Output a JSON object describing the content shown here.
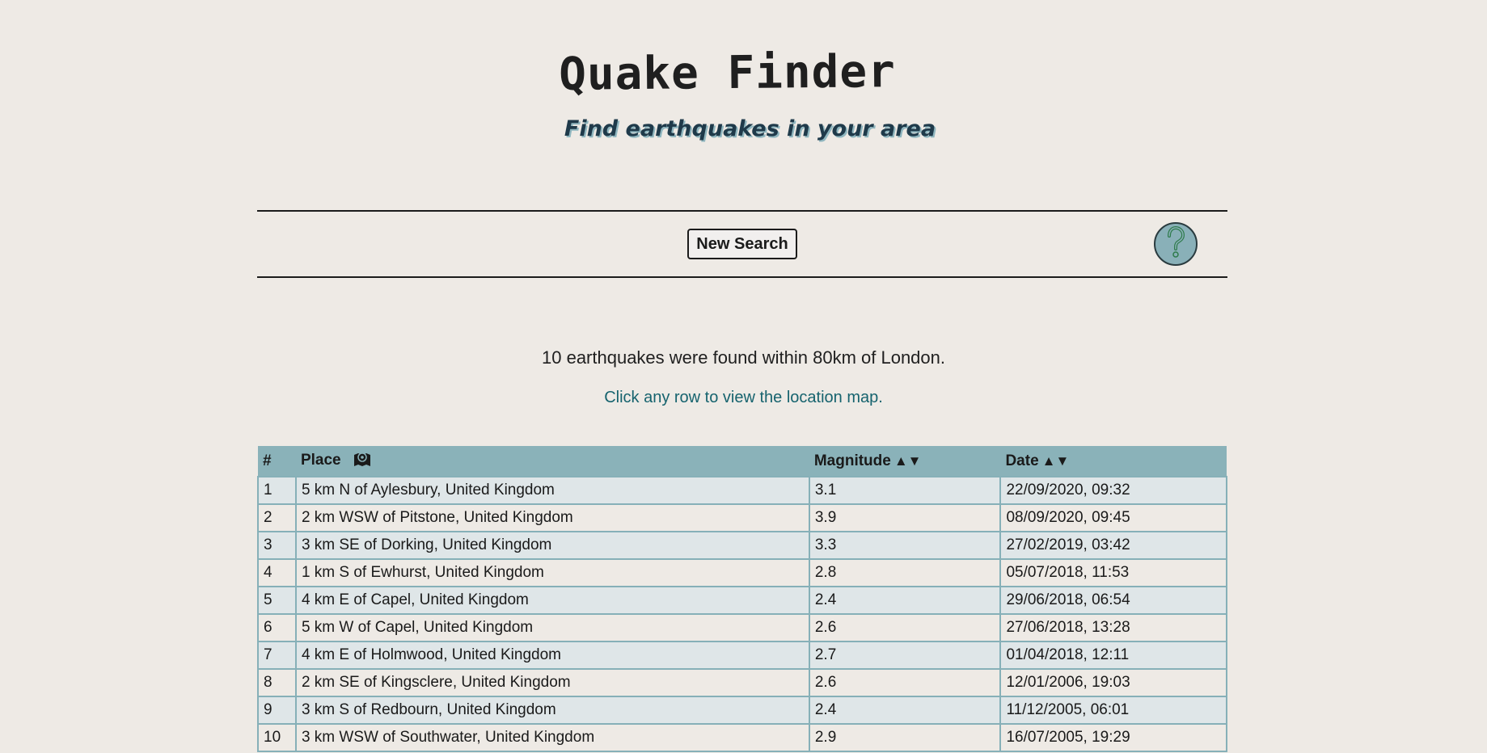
{
  "header": {
    "title": "Quake Finder",
    "subtitle": "Find earthquakes in your area"
  },
  "toolbar": {
    "new_search_label": "New Search",
    "help_icon": "question-mark-icon"
  },
  "results": {
    "summary": "10 earthquakes were found within 80km of London.",
    "hint": "Click any row to view the location map.",
    "columns": {
      "index": "#",
      "place": "Place",
      "magnitude": "Magnitude",
      "date": "Date",
      "sort_arrows": "▲▼",
      "place_icon": "map-marker-icon"
    },
    "rows": [
      {
        "n": "1",
        "place": "5 km N of Aylesbury, United Kingdom",
        "mag": "3.1",
        "date": "22/09/2020, 09:32"
      },
      {
        "n": "2",
        "place": "2 km WSW of Pitstone, United Kingdom",
        "mag": "3.9",
        "date": "08/09/2020, 09:45"
      },
      {
        "n": "3",
        "place": "3 km SE of Dorking, United Kingdom",
        "mag": "3.3",
        "date": "27/02/2019, 03:42"
      },
      {
        "n": "4",
        "place": "1 km S of Ewhurst, United Kingdom",
        "mag": "2.8",
        "date": "05/07/2018, 11:53"
      },
      {
        "n": "5",
        "place": "4 km E of Capel, United Kingdom",
        "mag": "2.4",
        "date": "29/06/2018, 06:54"
      },
      {
        "n": "6",
        "place": "5 km W of Capel, United Kingdom",
        "mag": "2.6",
        "date": "27/06/2018, 13:28"
      },
      {
        "n": "7",
        "place": "4 km E of Holmwood, United Kingdom",
        "mag": "2.7",
        "date": "01/04/2018, 12:11"
      },
      {
        "n": "8",
        "place": "2 km SE of Kingsclere, United Kingdom",
        "mag": "2.6",
        "date": "12/01/2006, 19:03"
      },
      {
        "n": "9",
        "place": "3 km S of Redbourn, United Kingdom",
        "mag": "2.4",
        "date": "11/12/2005, 06:01"
      },
      {
        "n": "10",
        "place": "3 km WSW of Southwater, United Kingdom",
        "mag": "2.9",
        "date": "16/07/2005, 19:29"
      }
    ]
  },
  "colors": {
    "background": "#eeeae5",
    "table_header": "#8ab2b9",
    "row_alt": "#dfe6e8",
    "hint_text": "#16636e",
    "help_button": "#89b0b8"
  }
}
